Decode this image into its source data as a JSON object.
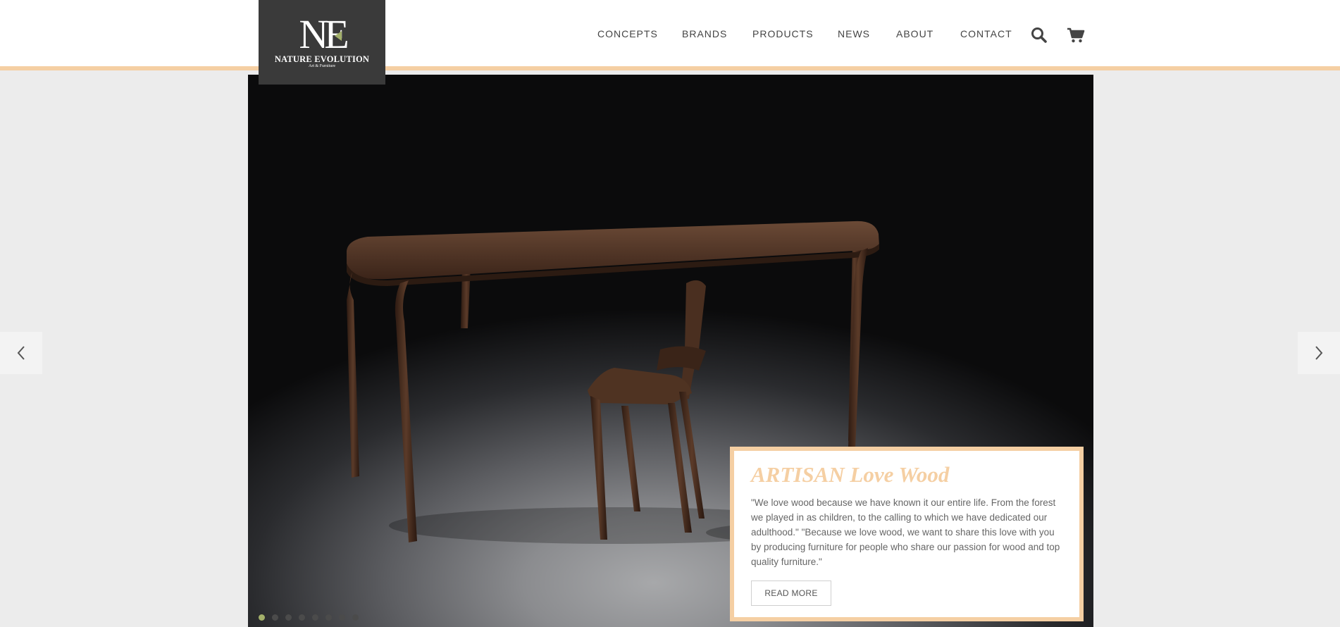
{
  "header": {
    "logo": {
      "monogram": "NE",
      "name": "NATURE EVOLUTION",
      "tagline": "Art & Furniture"
    },
    "nav": [
      "CONCEPTS",
      "BRANDS",
      "PRODUCTS",
      "NEWS",
      "ABOUT",
      "CONTACT"
    ],
    "icons": [
      "search-icon",
      "cart-icon"
    ]
  },
  "colors": {
    "accent": "#f5cfa3",
    "logo_bg": "#3a3a3a",
    "dot_active": "#a3b06a",
    "page_bg": "#ececec"
  },
  "slider": {
    "caption": {
      "title": "ARTISAN Love Wood",
      "body": "\"We love wood because we have known it our entire life. From the forest we played in as children, to the calling to which we have dedicated our adulthood.\" \"Because we love wood, we want to share this love with you by producing furniture for people who share our passion for wood and top quality furniture.\"",
      "button": "READ MORE"
    },
    "slide_count": 8,
    "active_slide": 1,
    "prev_icon": "chevron-left-icon",
    "next_icon": "chevron-right-icon"
  }
}
